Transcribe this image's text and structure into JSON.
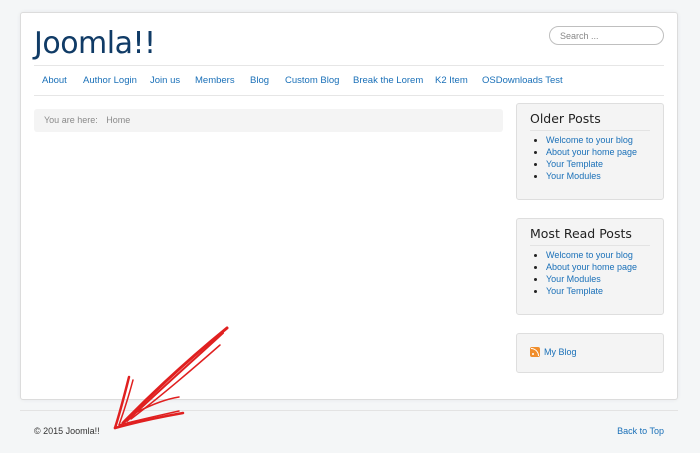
{
  "site": {
    "title": "Joomla!!"
  },
  "search": {
    "placeholder": "Search ..."
  },
  "nav": {
    "items": [
      {
        "label": "About"
      },
      {
        "label": "Author Login"
      },
      {
        "label": "Join us"
      },
      {
        "label": "Members"
      },
      {
        "label": "Blog"
      },
      {
        "label": "Custom Blog"
      },
      {
        "label": "Break the Lorem"
      },
      {
        "label": "K2 Item"
      },
      {
        "label": "OSDownloads Test"
      }
    ]
  },
  "breadcrumb": {
    "label": "You are here:",
    "home": "Home"
  },
  "older_posts": {
    "title": "Older Posts",
    "items": [
      "Welcome to your blog",
      "About your home page",
      "Your Template",
      "Your Modules"
    ]
  },
  "most_read": {
    "title": "Most Read Posts",
    "items": [
      "Welcome to your blog",
      "About your home page",
      "Your Modules",
      "Your Template"
    ]
  },
  "feed": {
    "label": "My Blog",
    "icon": "rss-icon"
  },
  "footer": {
    "copyright": "© 2015 Joomla!!",
    "back_to_top": "Back to Top"
  },
  "annotation": {
    "icon": "red-arrow",
    "color": "#e02020"
  },
  "colors": {
    "brand": "#103b66",
    "link": "#1a70b8",
    "rss": "#f08d2b"
  }
}
